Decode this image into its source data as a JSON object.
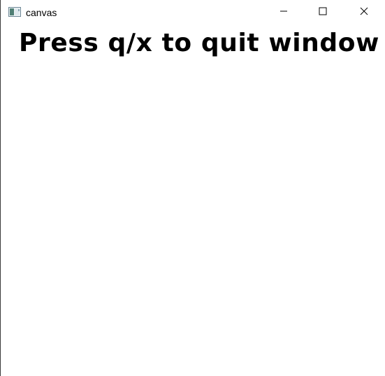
{
  "window": {
    "title": "canvas",
    "controls": {
      "minimize_icon": "minimize-icon",
      "maximize_icon": "maximize-icon",
      "close_icon": "close-icon"
    }
  },
  "canvas": {
    "text": "Press q/x to quit window",
    "background": "#ffffff",
    "text_color": "#000000"
  }
}
